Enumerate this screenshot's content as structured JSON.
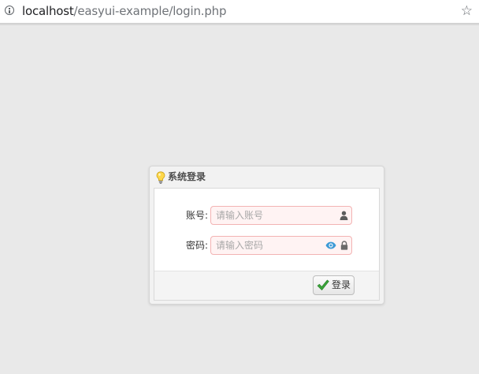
{
  "browser": {
    "url_host": "localhost",
    "url_path": "/easyui-example/login.php"
  },
  "login_panel": {
    "title": "系统登录",
    "account": {
      "label": "账号:",
      "placeholder": "请输入账号",
      "value": ""
    },
    "password": {
      "label": "密码:",
      "placeholder": "请输入密码",
      "value": ""
    },
    "submit_label": "登录"
  },
  "icons": {
    "address_info": "info-icon",
    "bookmark": "star-icon",
    "title": "lightbulb-icon",
    "account": "user-icon",
    "password_toggle": "eye-icon",
    "password": "lock-icon",
    "submit": "check-icon"
  },
  "colors": {
    "page_background": "#e9e9e9",
    "input_invalid_background": "#fff3f3",
    "input_invalid_border": "#f3b3b3",
    "eye_icon": "#3d9ad6",
    "check_icon": "#3aa53a"
  }
}
